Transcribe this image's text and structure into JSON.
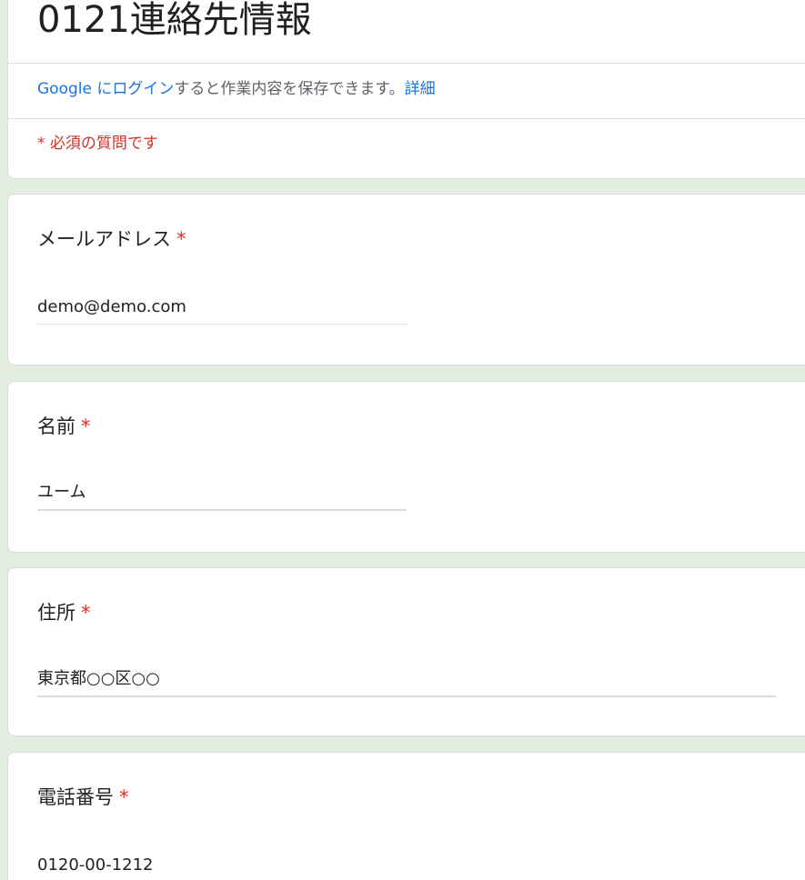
{
  "form": {
    "title": "0121連絡先情報",
    "login_link": "Google にログイン",
    "login_text": "すると作業内容を保存できます。",
    "details_link": "詳細",
    "required_note": "* 必須の質問です"
  },
  "questions": [
    {
      "label": "メールアドレス",
      "required_mark": "*",
      "value": "demo@demo.com"
    },
    {
      "label": "名前",
      "required_mark": "*",
      "value": "ユーム"
    },
    {
      "label": "住所",
      "required_mark": "*",
      "value": "東京都○○区○○"
    },
    {
      "label": "電話番号",
      "required_mark": "*",
      "value": "0120-00-1212"
    }
  ],
  "colors": {
    "background": "#e3ede0",
    "link": "#1a73e8",
    "required": "#d93025"
  }
}
